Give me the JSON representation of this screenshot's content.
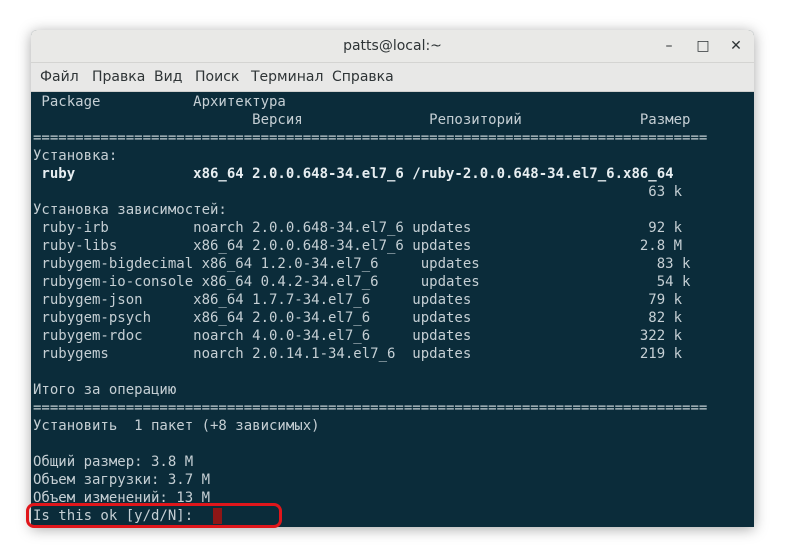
{
  "window": {
    "title": "patts@local:~",
    "controls": {
      "minimize": "–",
      "maximize": "□",
      "close": "✕"
    }
  },
  "menu": [
    "Файл",
    "Правка",
    "Вид",
    "Поиск",
    "Терминал",
    "Справка"
  ],
  "terminal": {
    "lines": [
      " Package           Архитектура",
      "                          Версия               Репозиторий              Размер",
      "================================================================================",
      "Установка:",
      " ruby              x86_64 2.0.0.648-34.el7_6 /ruby-2.0.0.648-34.el7_6.x86_64",
      "                                                                         63 k",
      "Установка зависимостей:",
      " ruby-irb          noarch 2.0.0.648-34.el7_6 updates                     92 k",
      " ruby-libs         x86_64 2.0.0.648-34.el7_6 updates                    2.8 M",
      " rubygem-bigdecimal x86_64 1.2.0-34.el7_6     updates                     83 k",
      " rubygem-io-console x86_64 0.4.2-34.el7_6     updates                     54 k",
      " rubygem-json      x86_64 1.7.7-34.el7_6     updates                     79 k",
      " rubygem-psych     x86_64 2.0.0-34.el7_6     updates                     82 k",
      " rubygem-rdoc      noarch 4.0.0-34.el7_6     updates                    322 k",
      " rubygems          noarch 2.0.14.1-34.el7_6  updates                    219 k",
      "",
      "Итого за операцию",
      "================================================================================",
      "Установить  1 пакет (+8 зависимых)",
      "",
      "Общий размер: 3.8 M",
      "Объем загрузки: 3.7 M",
      "Объем изменений: 13 M",
      "Is this ok [y/d/N]: "
    ]
  },
  "colors": {
    "terminal_bg": "#0b2c3a",
    "text": "#c5cfd4",
    "highlight": "#e0161b",
    "cursor": "#8e1616"
  }
}
